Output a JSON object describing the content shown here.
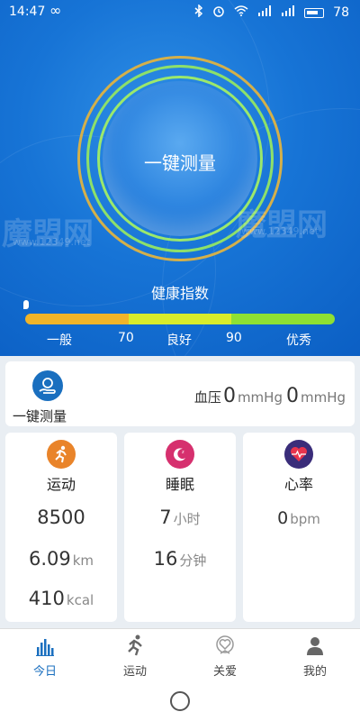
{
  "status": {
    "time": "14:47",
    "loop_icon": "∞",
    "battery": "78"
  },
  "hero": {
    "measure_label": "一键测量",
    "health_title": "健康指数",
    "watermark_left": "魔盟网",
    "watermark_left_sub": "www.12349.net",
    "watermark_right": "魔盟网",
    "watermark_right_sub": "www.12349.net",
    "scale": {
      "low": "一般",
      "t1": "70",
      "mid": "良好",
      "t2": "90",
      "high": "优秀"
    },
    "colors": {
      "low": "#f0b429",
      "mid": "#d8ec2b",
      "high": "#8ee033",
      "ring_gold": "#d4b04a",
      "ring_green": "#8de06a"
    }
  },
  "measure_card": {
    "button_label": "一键测量",
    "bp_label": "血压",
    "sys": "0",
    "unit1": "mmHg",
    "dia": "0",
    "unit2": "mmHg"
  },
  "sport": {
    "title": "运动",
    "steps": "8500",
    "distance": "6.09",
    "distance_unit": "km",
    "calories": "410",
    "calories_unit": "kcal",
    "icon_color": "#e9842a"
  },
  "sleep": {
    "title": "睡眠",
    "hours": "7",
    "hours_unit": "小时",
    "minutes": "16",
    "minutes_unit": "分钟",
    "icon_color": "#d6306e"
  },
  "heart": {
    "title": "心率",
    "bpm": "0",
    "bpm_unit": "bpm",
    "icon_color": "#3a2d7a"
  },
  "nav": {
    "items": [
      {
        "label": "今日",
        "icon": "bar-chart-icon"
      },
      {
        "label": "运动",
        "icon": "runner-icon"
      },
      {
        "label": "关爱",
        "icon": "heart-care-icon"
      },
      {
        "label": "我的",
        "icon": "person-icon"
      }
    ]
  }
}
